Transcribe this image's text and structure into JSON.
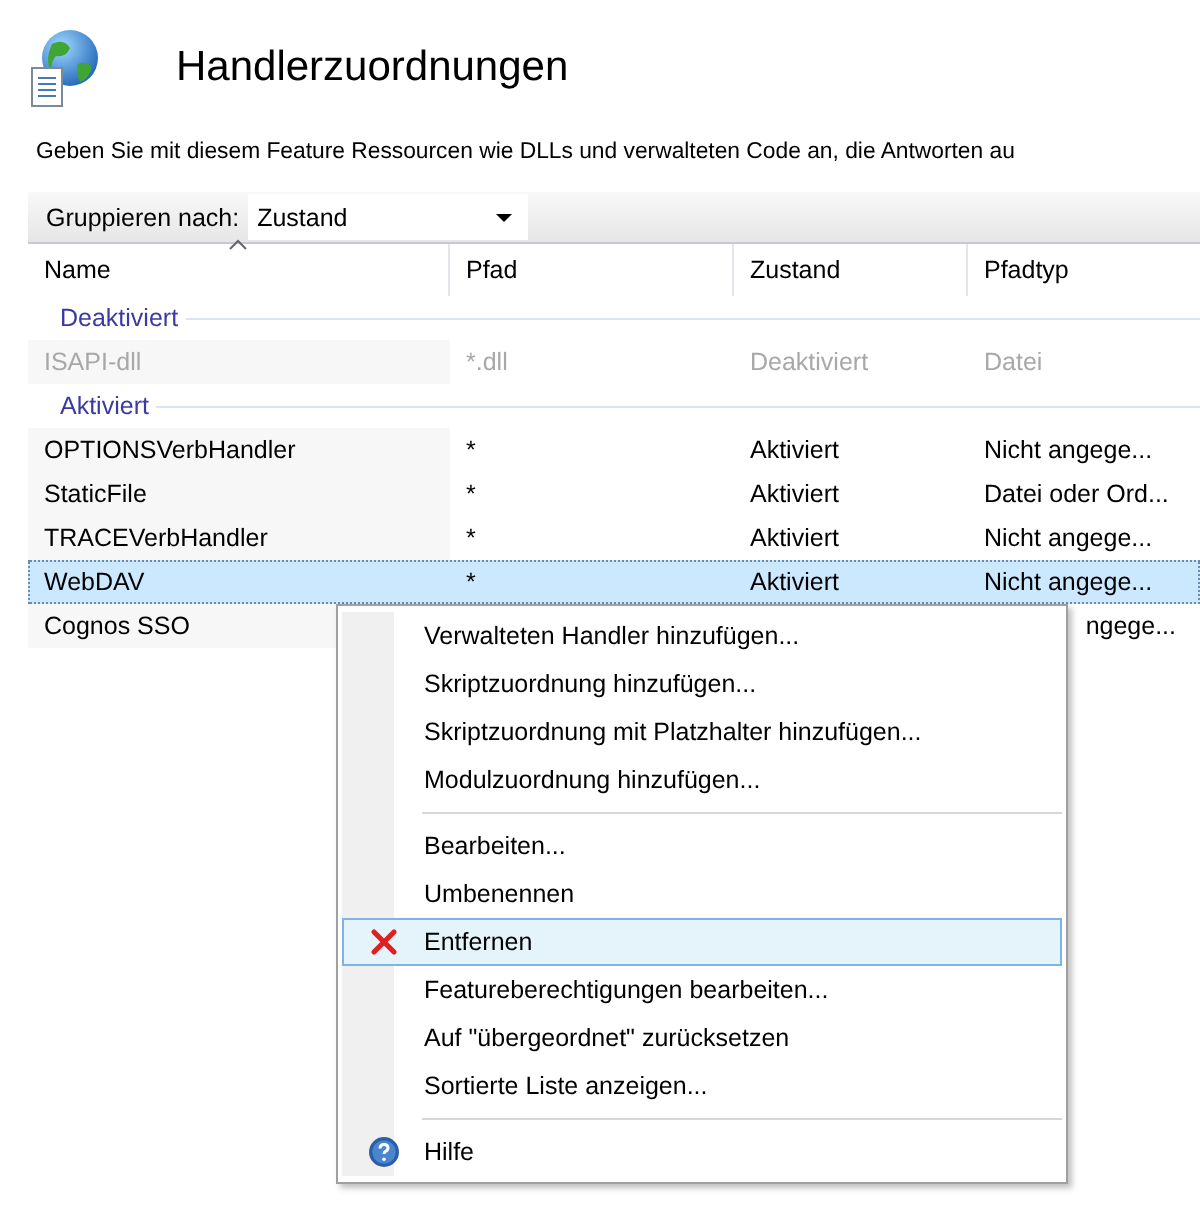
{
  "title": "Handlerzuordnungen",
  "description": "Geben Sie mit diesem Feature Ressourcen wie DLLs und verwalteten Code an, die Antworten au",
  "toolbar": {
    "group_label": "Gruppieren nach:",
    "group_value": "Zustand"
  },
  "table": {
    "columns": [
      {
        "label": "Name",
        "sorted": true
      },
      {
        "label": "Pfad",
        "sorted": false
      },
      {
        "label": "Zustand",
        "sorted": false
      },
      {
        "label": "Pfadtyp",
        "sorted": false
      }
    ],
    "groups": [
      {
        "label": "Deaktiviert",
        "rows": [
          {
            "name": "ISAPI-dll",
            "path": "*.dll",
            "state": "Deaktiviert",
            "path_type": "Datei",
            "disabled": true,
            "selected": false
          }
        ]
      },
      {
        "label": "Aktiviert",
        "rows": [
          {
            "name": "OPTIONSVerbHandler",
            "path": "*",
            "state": "Aktiviert",
            "path_type": "Nicht angege...",
            "disabled": false,
            "selected": false
          },
          {
            "name": "StaticFile",
            "path": "*",
            "state": "Aktiviert",
            "path_type": "Datei oder Ord...",
            "disabled": false,
            "selected": false
          },
          {
            "name": "TRACEVerbHandler",
            "path": "*",
            "state": "Aktiviert",
            "path_type": "Nicht angege...",
            "disabled": false,
            "selected": false
          },
          {
            "name": "WebDAV",
            "path": "*",
            "state": "Aktiviert",
            "path_type": "Nicht angege...",
            "disabled": false,
            "selected": true
          },
          {
            "name": "Cognos SSO",
            "path_type": "ngege...",
            "disabled": false,
            "selected": false,
            "partly_covered": true
          }
        ]
      }
    ]
  },
  "context_menu": {
    "items": [
      {
        "kind": "item",
        "label": "Verwalteten Handler hinzufügen...",
        "selected": false
      },
      {
        "kind": "item",
        "label": "Skriptzuordnung hinzufügen...",
        "selected": false
      },
      {
        "kind": "item",
        "label": "Skriptzuordnung mit Platzhalter hinzufügen...",
        "selected": false
      },
      {
        "kind": "item",
        "label": "Modulzuordnung hinzufügen...",
        "selected": false
      },
      {
        "kind": "separator"
      },
      {
        "kind": "item",
        "label": "Bearbeiten...",
        "selected": false
      },
      {
        "kind": "item",
        "label": "Umbenennen",
        "selected": false
      },
      {
        "kind": "remove",
        "label": "Entfernen",
        "selected": true
      },
      {
        "kind": "item",
        "label": "Featureberechtigungen bearbeiten...",
        "selected": false
      },
      {
        "kind": "item",
        "label": "Auf \"übergeordnet\" zurücksetzen",
        "selected": false
      },
      {
        "kind": "item",
        "label": "Sortierte Liste anzeigen...",
        "selected": false
      },
      {
        "kind": "separator"
      },
      {
        "kind": "help",
        "label": "Hilfe",
        "selected": false
      }
    ]
  }
}
